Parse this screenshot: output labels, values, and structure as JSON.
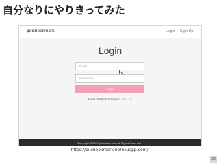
{
  "slide": {
    "title": "自分なりにやりきってみた",
    "caption": "https://pilebookmark.herokuapp.com/",
    "page_number": "26"
  },
  "navbar": {
    "brand_bold": "pile",
    "brand_rest": "Bookmark",
    "login_link": "Login",
    "signup_link": "Sign Up"
  },
  "login_form": {
    "heading": "Login",
    "email_placeholder": "Email",
    "password_placeholder": "Password",
    "login_button": "Login",
    "signup_prompt": "Don't have an account?",
    "signup_link": "Sign Up"
  },
  "footer": {
    "copyright": "Copyright © 2017 pilebookmark. All Rights Reserved"
  },
  "colors": {
    "accent_pink": "#f7a0b5",
    "footer_bg": "#2b2b2b",
    "page_bg": "#f5f5f5"
  }
}
